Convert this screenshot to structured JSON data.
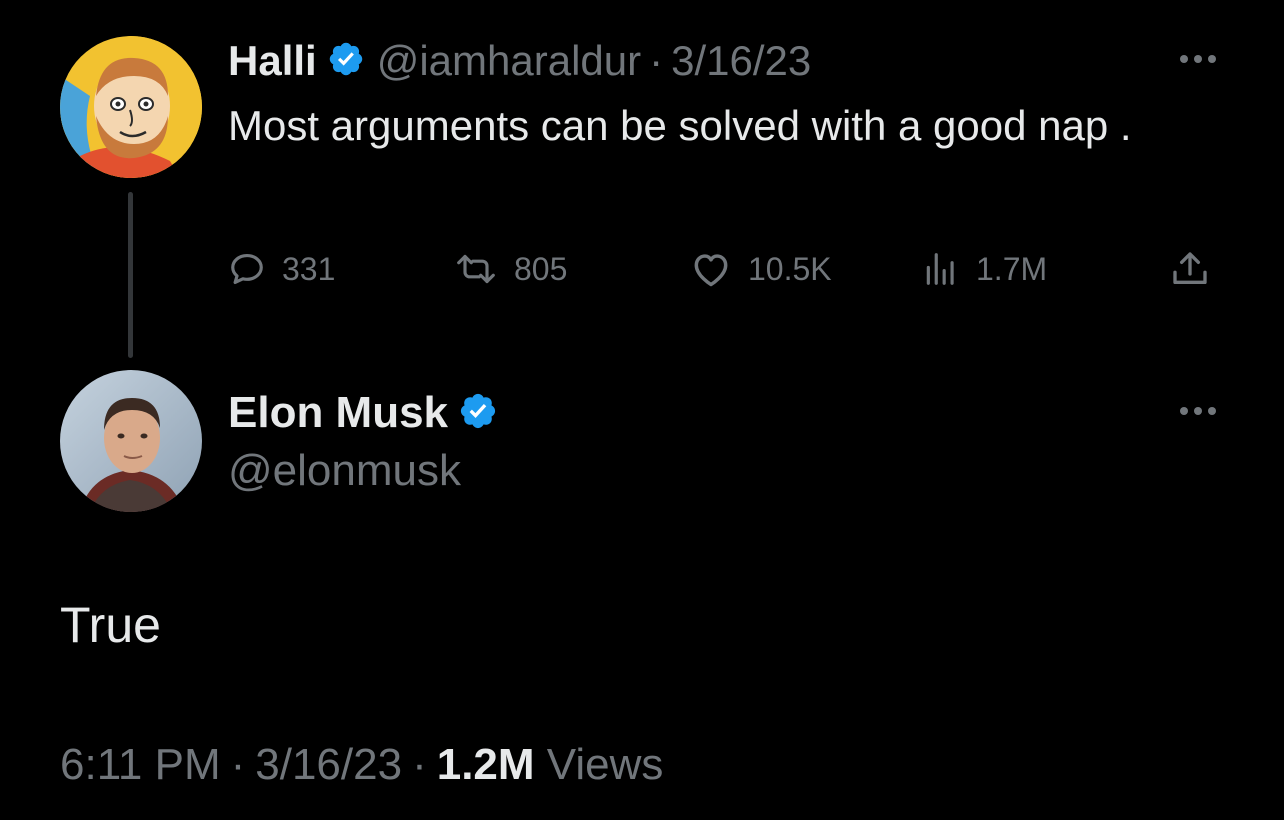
{
  "parent_tweet": {
    "author": {
      "display_name": "Halli",
      "handle": "@iamharaldur",
      "verified": true,
      "avatar_icon": "cartoon-bearded-man-avatar"
    },
    "separator": "·",
    "date": "3/16/23",
    "text": "Most arguments can be solved with a good nap .",
    "actions": {
      "replies": "331",
      "retweets": "805",
      "likes": "10.5K",
      "views": "1.7M"
    }
  },
  "reply_tweet": {
    "author": {
      "display_name": "Elon Musk",
      "handle": "@elonmusk",
      "verified": true,
      "avatar_icon": "portrait-photo-avatar"
    },
    "text": "True",
    "meta": {
      "time": "6:11 PM",
      "separator": "·",
      "date": "3/16/23",
      "views_count": "1.2M",
      "views_label": "Views"
    }
  },
  "colors": {
    "background": "#000000",
    "primary_text": "#e7e9ea",
    "secondary_text": "#71767b",
    "verified_blue": "#1d9bf0",
    "thread_line": "#333639"
  }
}
